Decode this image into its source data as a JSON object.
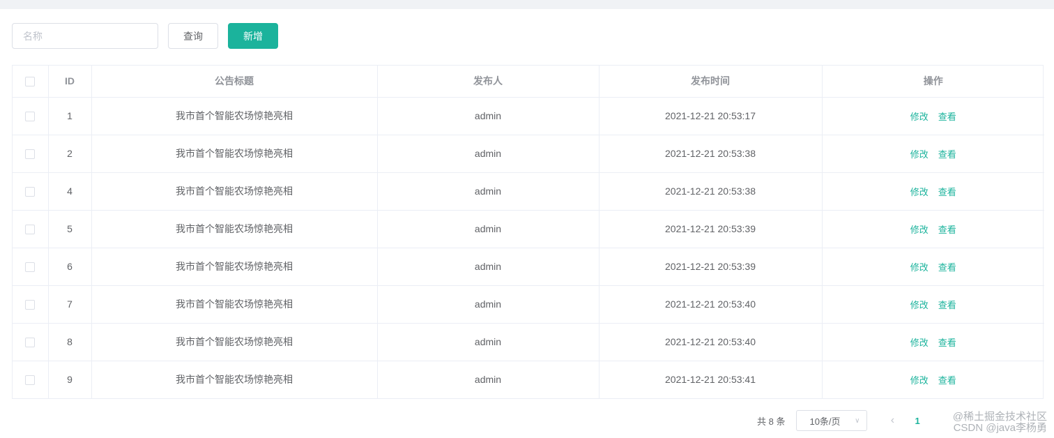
{
  "search": {
    "placeholder": "名称"
  },
  "toolbar": {
    "query_label": "查询",
    "add_label": "新增"
  },
  "table": {
    "columns": [
      "ID",
      "公告标题",
      "发布人",
      "发布时间",
      "操作"
    ],
    "rows": [
      {
        "id": "1",
        "title": "我市首个智能农场惊艳亮相",
        "publisher": "admin",
        "time": "2021-12-21 20:53:17"
      },
      {
        "id": "2",
        "title": "我市首个智能农场惊艳亮相",
        "publisher": "admin",
        "time": "2021-12-21 20:53:38"
      },
      {
        "id": "4",
        "title": "我市首个智能农场惊艳亮相",
        "publisher": "admin",
        "time": "2021-12-21 20:53:38"
      },
      {
        "id": "5",
        "title": "我市首个智能农场惊艳亮相",
        "publisher": "admin",
        "time": "2021-12-21 20:53:39"
      },
      {
        "id": "6",
        "title": "我市首个智能农场惊艳亮相",
        "publisher": "admin",
        "time": "2021-12-21 20:53:39"
      },
      {
        "id": "7",
        "title": "我市首个智能农场惊艳亮相",
        "publisher": "admin",
        "time": "2021-12-21 20:53:40"
      },
      {
        "id": "8",
        "title": "我市首个智能农场惊艳亮相",
        "publisher": "admin",
        "time": "2021-12-21 20:53:40"
      },
      {
        "id": "9",
        "title": "我市首个智能农场惊艳亮相",
        "publisher": "admin",
        "time": "2021-12-21 20:53:41"
      }
    ],
    "edit_label": "修改",
    "view_label": "查看"
  },
  "pagination": {
    "total_label": "共 8 条",
    "page_size_label": "10条/页",
    "current_page": "1"
  },
  "watermark": {
    "line1": "@稀土掘金技术社区",
    "line2": "CSDN @java李杨勇"
  },
  "colors": {
    "accent": "#1bb39c",
    "border": "#dcdfe6",
    "header_text": "#909399"
  }
}
